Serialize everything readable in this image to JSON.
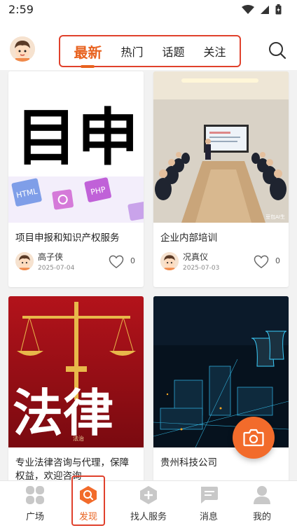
{
  "status_bar": {
    "time": "2:59"
  },
  "header": {
    "tabs": [
      {
        "label": "最新",
        "active": true
      },
      {
        "label": "热门",
        "active": false
      },
      {
        "label": "话题",
        "active": false
      },
      {
        "label": "关注",
        "active": false
      }
    ],
    "search_icon": "search-icon"
  },
  "cards": [
    {
      "title": "项目申报和知识产权服务",
      "author": "高子侠",
      "date": "2025-07-04",
      "likes": "0",
      "image": {
        "big_text": "目申",
        "badges": [
          "HTML",
          "PHP"
        ]
      }
    },
    {
      "title": "企业内部培训",
      "author": "况真仪",
      "date": "2025-07-03",
      "likes": "0",
      "image": {
        "watermark": "豆包AI生"
      }
    },
    {
      "title": "专业法律咨询与代理，保障权益，欢迎咨询",
      "author": "",
      "date": "",
      "likes": "",
      "image": {
        "big_text": "法律",
        "small_text": "法治"
      }
    },
    {
      "title": "贵州科技公司",
      "author": "",
      "date": "",
      "likes": "",
      "image": {}
    }
  ],
  "fab": {
    "icon": "camera-icon"
  },
  "bottom_nav": {
    "items": [
      {
        "label": "广场",
        "icon": "square-grid-icon",
        "active": false
      },
      {
        "label": "发现",
        "icon": "discover-icon",
        "active": true
      },
      {
        "label": "找人服务",
        "icon": "add-service-icon",
        "active": false
      },
      {
        "label": "消息",
        "icon": "message-icon",
        "active": false
      },
      {
        "label": "我的",
        "icon": "profile-icon",
        "active": false
      }
    ]
  },
  "colors": {
    "accent": "#e8621f",
    "highlight_border": "#e0412c",
    "fab": "#f26b2b"
  }
}
